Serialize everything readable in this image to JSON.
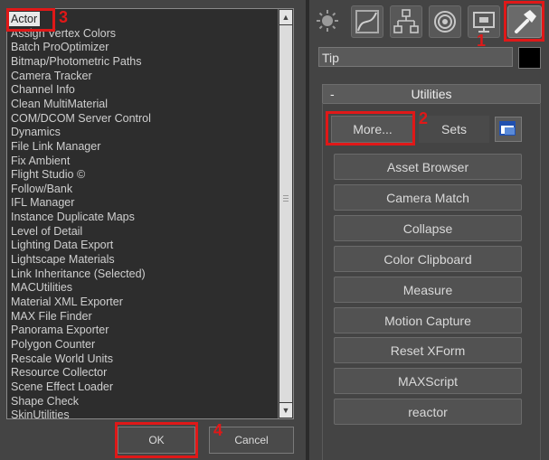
{
  "dialog": {
    "list_items": [
      "Actor",
      "Assign Vertex Colors",
      "Batch ProOptimizer",
      "Bitmap/Photometric Paths",
      "Camera Tracker",
      "Channel Info",
      "Clean MultiMaterial",
      "COM/DCOM Server Control",
      "Dynamics",
      "File Link Manager",
      "Fix Ambient",
      "Flight Studio ©",
      "Follow/Bank",
      "IFL Manager",
      "Instance Duplicate Maps",
      "Level of Detail",
      "Lighting Data Export",
      "Lightscape Materials",
      "Link Inheritance (Selected)",
      "MACUtilities",
      "Material XML Exporter",
      "MAX File Finder",
      "Panorama Exporter",
      "Polygon Counter",
      "Rescale World Units",
      "Resource Collector",
      "Scene Effect Loader",
      "Shape Check",
      "SkinUtilities"
    ],
    "selected_index": 0,
    "ok_label": "OK",
    "cancel_label": "Cancel"
  },
  "command_panel": {
    "tabs": [
      {
        "name": "create-tab",
        "icon": "sun-icon"
      },
      {
        "name": "modify-tab",
        "icon": "modify-curve-icon"
      },
      {
        "name": "hierarchy-tab",
        "icon": "hierarchy-icon"
      },
      {
        "name": "motion-tab",
        "icon": "motion-icon"
      },
      {
        "name": "display-tab",
        "icon": "display-monitor-icon"
      },
      {
        "name": "utilities-tab",
        "icon": "hammer-icon"
      }
    ],
    "tip_value": "Tip",
    "rollup": {
      "minus": "-",
      "title": "Utilities",
      "more_label": "More...",
      "sets_label": "Sets",
      "buttons": [
        "Asset Browser",
        "Camera Match",
        "Collapse",
        "Color Clipboard",
        "Measure",
        "Motion Capture",
        "Reset XForm",
        "MAXScript",
        "reactor"
      ]
    }
  },
  "annotations": {
    "n1": "1",
    "n2": "2",
    "n3": "3",
    "n4": "4",
    "color": "#e01818"
  }
}
